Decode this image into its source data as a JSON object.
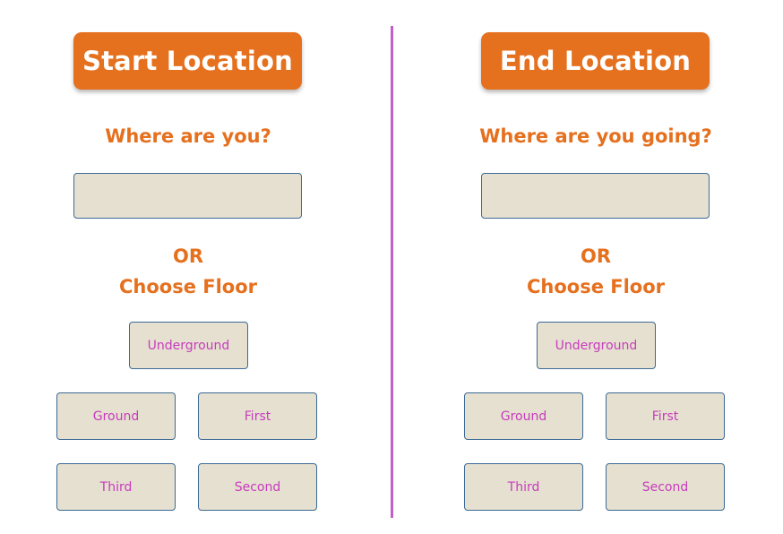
{
  "start": {
    "title": "Start Location",
    "question": "Where are you?",
    "input_value": "",
    "or_label": "OR",
    "choose_label": "Choose Floor",
    "floors": {
      "underground": "Underground",
      "ground": "Ground",
      "first": "First",
      "third": "Third",
      "second": "Second"
    }
  },
  "end": {
    "title": "End Location",
    "question": "Where are you going?",
    "input_value": "",
    "or_label": "OR",
    "choose_label": "Choose Floor",
    "floors": {
      "underground": "Underground",
      "ground": "Ground",
      "first": "First",
      "third": "Third",
      "second": "Second"
    }
  },
  "colors": {
    "accent": "#e5701e",
    "divider": "#c060c8",
    "button_fill": "#e5e0cf",
    "button_border": "#3d6a96",
    "button_text": "#c83cbe"
  }
}
